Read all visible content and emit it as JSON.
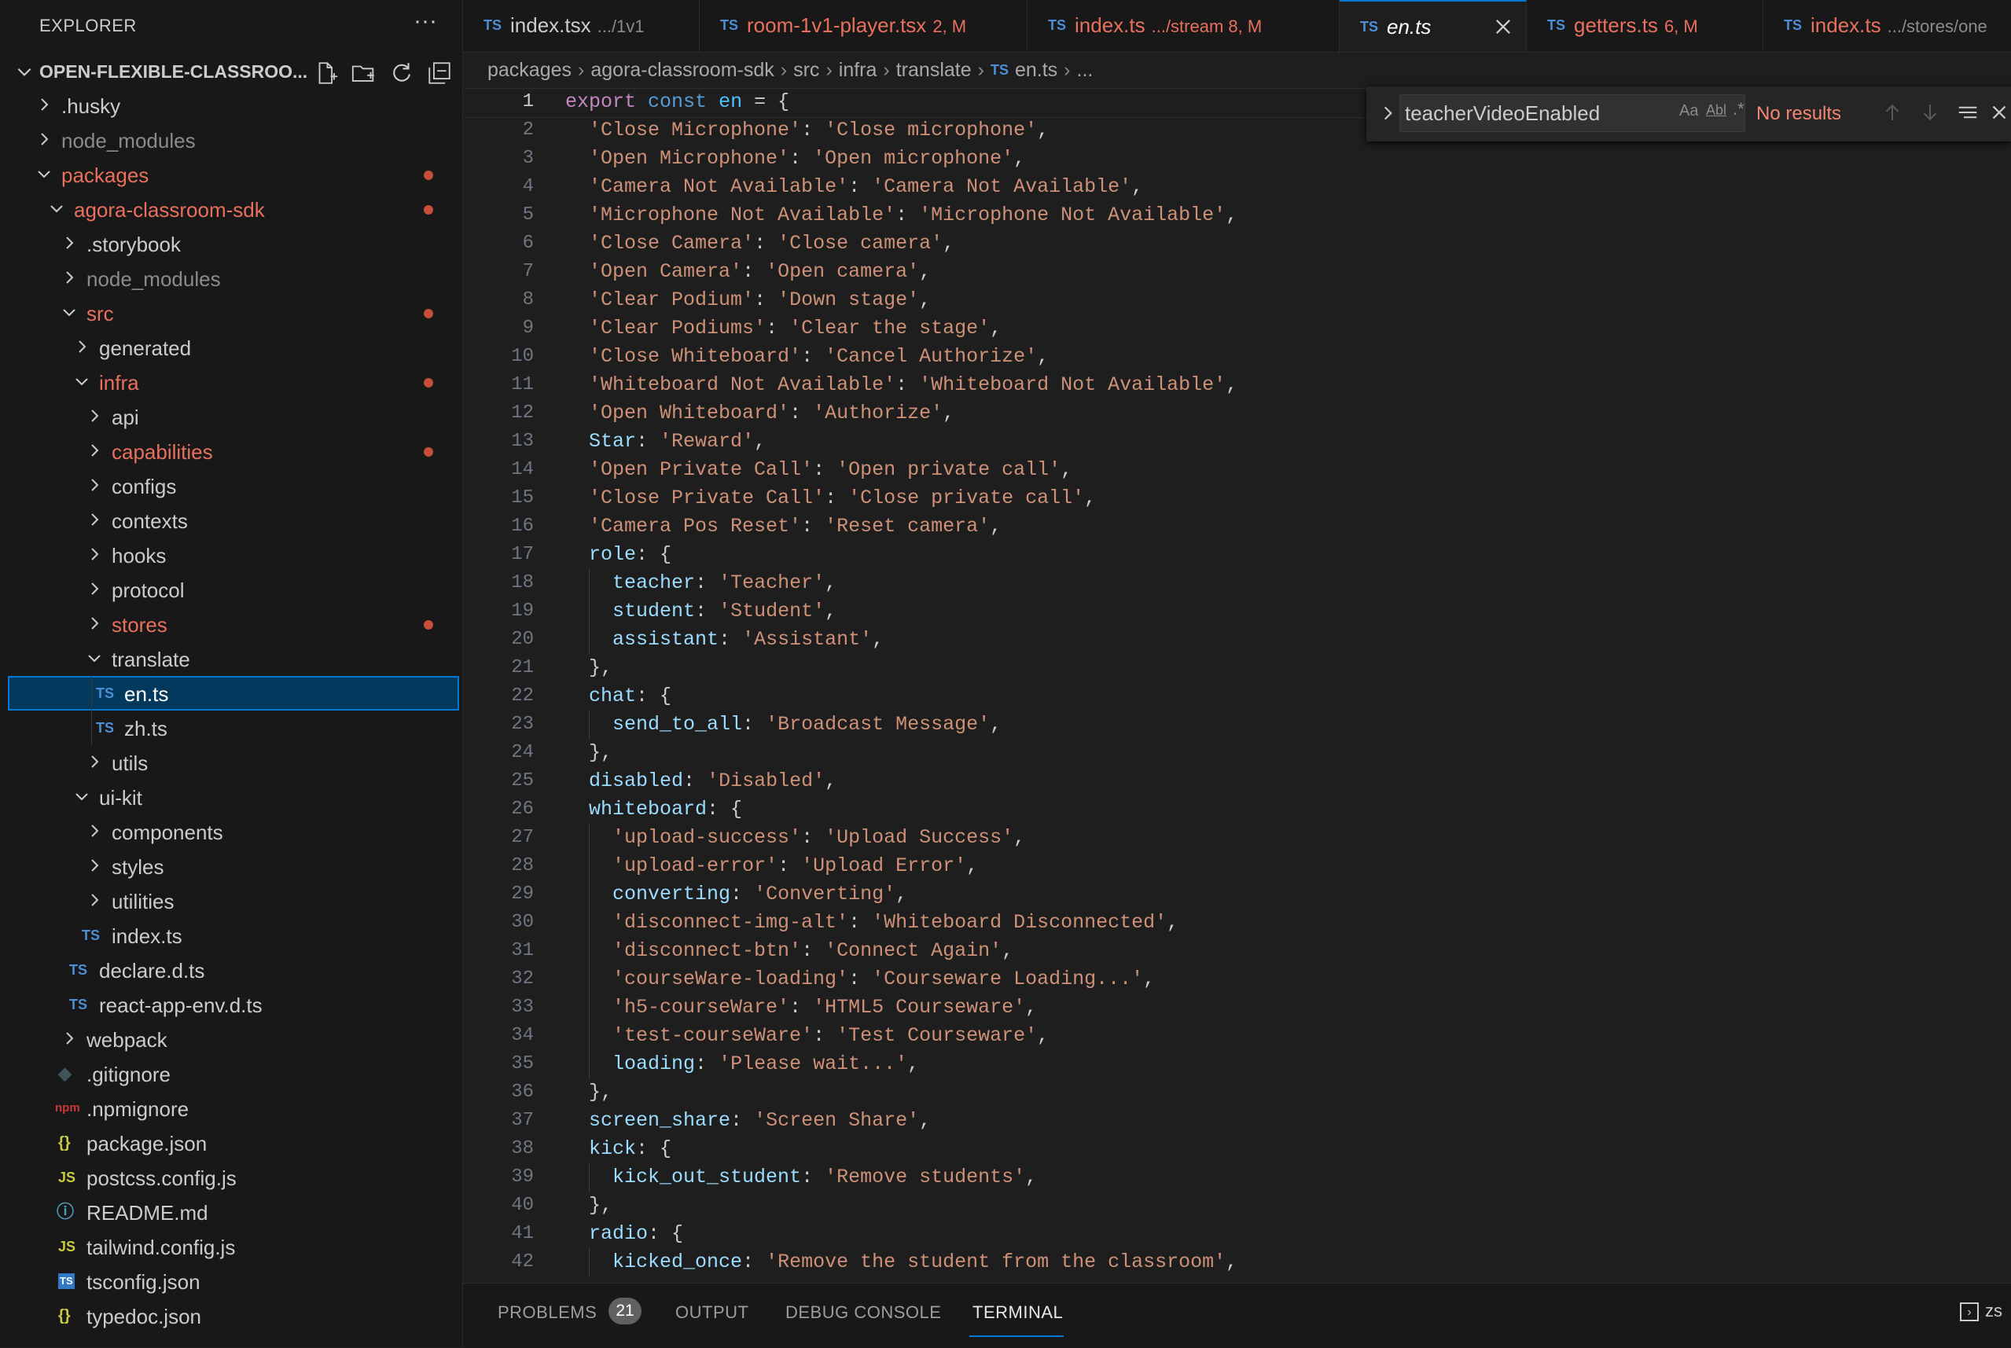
{
  "explorer": {
    "title": "EXPLORER",
    "more": "···",
    "root_label": "OPEN-FLEXIBLE-CLASSROO...",
    "tree": [
      {
        "label": ".husky",
        "icon": "",
        "expanded": false
      },
      {
        "label": "node_modules",
        "icon": "",
        "expanded": false
      },
      {
        "label": "packages",
        "icon": "",
        "expanded": true
      },
      {
        "label": "agora-classroom-sdk",
        "icon": "",
        "expanded": true
      },
      {
        "label": ".storybook",
        "icon": "",
        "expanded": false
      },
      {
        "label": "node_modules",
        "icon": "",
        "expanded": false
      },
      {
        "label": "src",
        "icon": "",
        "expanded": true
      },
      {
        "label": "generated",
        "icon": "",
        "expanded": false
      },
      {
        "label": "infra",
        "icon": "",
        "expanded": true
      },
      {
        "label": "api",
        "icon": "",
        "expanded": false
      },
      {
        "label": "capabilities",
        "icon": "",
        "expanded": false
      },
      {
        "label": "configs",
        "icon": "",
        "expanded": false
      },
      {
        "label": "contexts",
        "icon": "",
        "expanded": false
      },
      {
        "label": "hooks",
        "icon": "",
        "expanded": false
      },
      {
        "label": "protocol",
        "icon": "",
        "expanded": false
      },
      {
        "label": "stores",
        "icon": "",
        "expanded": false
      },
      {
        "label": "translate",
        "icon": "",
        "expanded": true
      },
      {
        "label": "en.ts",
        "icon": "TS"
      },
      {
        "label": "zh.ts",
        "icon": "TS"
      },
      {
        "label": "utils",
        "icon": "",
        "expanded": false
      },
      {
        "label": "ui-kit",
        "icon": "",
        "expanded": true
      },
      {
        "label": "components",
        "icon": "",
        "expanded": false
      },
      {
        "label": "styles",
        "icon": "",
        "expanded": false
      },
      {
        "label": "utilities",
        "icon": "",
        "expanded": false
      },
      {
        "label": "index.ts",
        "icon": "TS"
      },
      {
        "label": "declare.d.ts",
        "icon": "TS"
      },
      {
        "label": "react-app-env.d.ts",
        "icon": "TS"
      },
      {
        "label": "webpack",
        "icon": "",
        "expanded": false
      },
      {
        "label": ".gitignore",
        "icon": "◆"
      },
      {
        "label": ".npmignore",
        "icon": "npm"
      },
      {
        "label": "package.json",
        "icon": "{}"
      },
      {
        "label": "postcss.config.js",
        "icon": "JS"
      },
      {
        "label": "README.md",
        "icon": "ⓘ"
      },
      {
        "label": "tailwind.config.js",
        "icon": "JS"
      },
      {
        "label": "tsconfig.json",
        "icon": "TS"
      },
      {
        "label": "typedoc.json",
        "icon": "{}"
      }
    ]
  },
  "tabs": [
    {
      "icon": "TS",
      "name": "index.tsx",
      "desc": ".../1v1"
    },
    {
      "icon": "TS",
      "name": "room-1v1-player.tsx",
      "desc": "2, M"
    },
    {
      "icon": "TS",
      "name": "index.ts",
      "desc": ".../stream  8, M"
    },
    {
      "icon": "TS",
      "name": "en.ts",
      "desc": ""
    },
    {
      "icon": "TS",
      "name": "getters.ts",
      "desc": "6, M"
    },
    {
      "icon": "TS",
      "name": "index.ts",
      "desc": ".../stores/one"
    }
  ],
  "breadcrumb": [
    "packages",
    "agora-classroom-sdk",
    "src",
    "infra",
    "translate",
    "en.ts",
    "..."
  ],
  "find": {
    "query": "teacherVideoEnabled",
    "match_case": "Aa",
    "whole_word": "Abl",
    "regex": ".*",
    "status": "No results"
  },
  "code_lines": [
    "export const en = {",
    "  'Close Microphone': 'Close microphone',",
    "  'Open Microphone': 'Open microphone',",
    "  'Camera Not Available': 'Camera Not Available',",
    "  'Microphone Not Available': 'Microphone Not Available',",
    "  'Close Camera': 'Close camera',",
    "  'Open Camera': 'Open camera',",
    "  'Clear Podium': 'Down stage',",
    "  'Clear Podiums': 'Clear the stage',",
    "  'Close Whiteboard': 'Cancel Authorize',",
    "  'Whiteboard Not Available': 'Whiteboard Not Available',",
    "  'Open Whiteboard': 'Authorize',",
    "  Star: 'Reward',",
    "  'Open Private Call': 'Open private call',",
    "  'Close Private Call': 'Close private call',",
    "  'Camera Pos Reset': 'Reset camera',",
    "  role: {",
    "    teacher: 'Teacher',",
    "    student: 'Student',",
    "    assistant: 'Assistant',",
    "  },",
    "  chat: {",
    "    send_to_all: 'Broadcast Message',",
    "  },",
    "  disabled: 'Disabled',",
    "  whiteboard: {",
    "    'upload-success': 'Upload Success',",
    "    'upload-error': 'Upload Error',",
    "    converting: 'Converting',",
    "    'disconnect-img-alt': 'Whiteboard Disconnected',",
    "    'disconnect-btn': 'Connect Again',",
    "    'courseWare-loading': 'Courseware Loading...',",
    "    'h5-courseWare': 'HTML5 Courseware',",
    "    'test-courseWare': 'Test Courseware',",
    "    loading: 'Please wait...',",
    "  },",
    "  screen_share: 'Screen Share',",
    "  kick: {",
    "    kick_out_student: 'Remove students',",
    "  },",
    "  radio: {",
    "    kicked_once: 'Remove the student from the classroom',"
  ],
  "panel": {
    "tabs": [
      "PROBLEMS",
      "OUTPUT",
      "DEBUG CONSOLE",
      "TERMINAL"
    ],
    "problems_count": "21",
    "terminal_shell": "zs"
  },
  "colors": {
    "accent": "#0078d4",
    "modified": "#e8705d",
    "string": "#ce9178",
    "property": "#9cdcfe",
    "keyword": "#c586c0"
  }
}
